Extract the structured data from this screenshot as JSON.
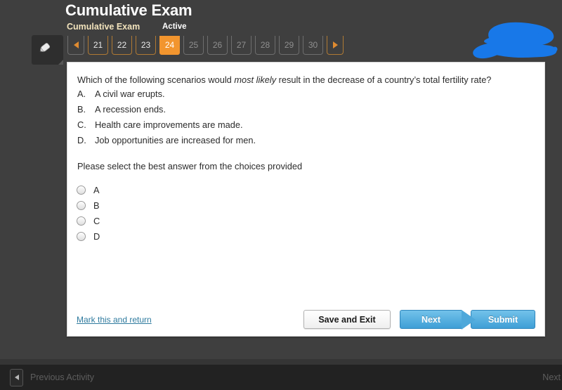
{
  "header": {
    "title": "Cumulative Exam",
    "subtitle": "Cumulative Exam",
    "status": "Active",
    "pencil_icon": "pencil-icon",
    "doodle_color": "#1878e8",
    "background_color": "#3f3f3f",
    "accent_color": "#f2952e",
    "subtitle_color": "#f2e3bc"
  },
  "pager": {
    "prev_arrow": "◀",
    "next_arrow": "▶",
    "pages": [
      {
        "label": "21",
        "state": "visited"
      },
      {
        "label": "22",
        "state": "visited"
      },
      {
        "label": "23",
        "state": "visited"
      },
      {
        "label": "24",
        "state": "active"
      },
      {
        "label": "25",
        "state": "locked"
      },
      {
        "label": "26",
        "state": "locked"
      },
      {
        "label": "27",
        "state": "locked"
      },
      {
        "label": "28",
        "state": "locked"
      },
      {
        "label": "29",
        "state": "locked"
      },
      {
        "label": "30",
        "state": "locked"
      }
    ]
  },
  "question": {
    "stem_before": "Which of the following scenarios would ",
    "stem_italic": "most likely",
    "stem_after": " result in the decrease of a country’s total fertility rate?",
    "choices": [
      {
        "letter": "A.",
        "text": "A civil war erupts."
      },
      {
        "letter": "B.",
        "text": "A recession ends."
      },
      {
        "letter": "C.",
        "text": "Health care improvements are made."
      },
      {
        "letter": "D.",
        "text": "Job opportunities are increased for men."
      }
    ],
    "instruction": "Please select the best answer from the choices provided",
    "options": [
      {
        "label": "A",
        "selected": false
      },
      {
        "label": "B",
        "selected": false
      },
      {
        "label": "C",
        "selected": false
      },
      {
        "label": "D",
        "selected": false
      }
    ]
  },
  "footer": {
    "mark_link": "Mark this and return",
    "save_label": "Save and Exit",
    "next_label": "Next",
    "submit_label": "Submit",
    "link_color": "#2e7a9e",
    "blue_button_color": "#3f9fd6"
  },
  "bottombar": {
    "prev_icon": "left-arrow-icon",
    "prev_label": "Previous Activity",
    "next_label": "Next"
  }
}
